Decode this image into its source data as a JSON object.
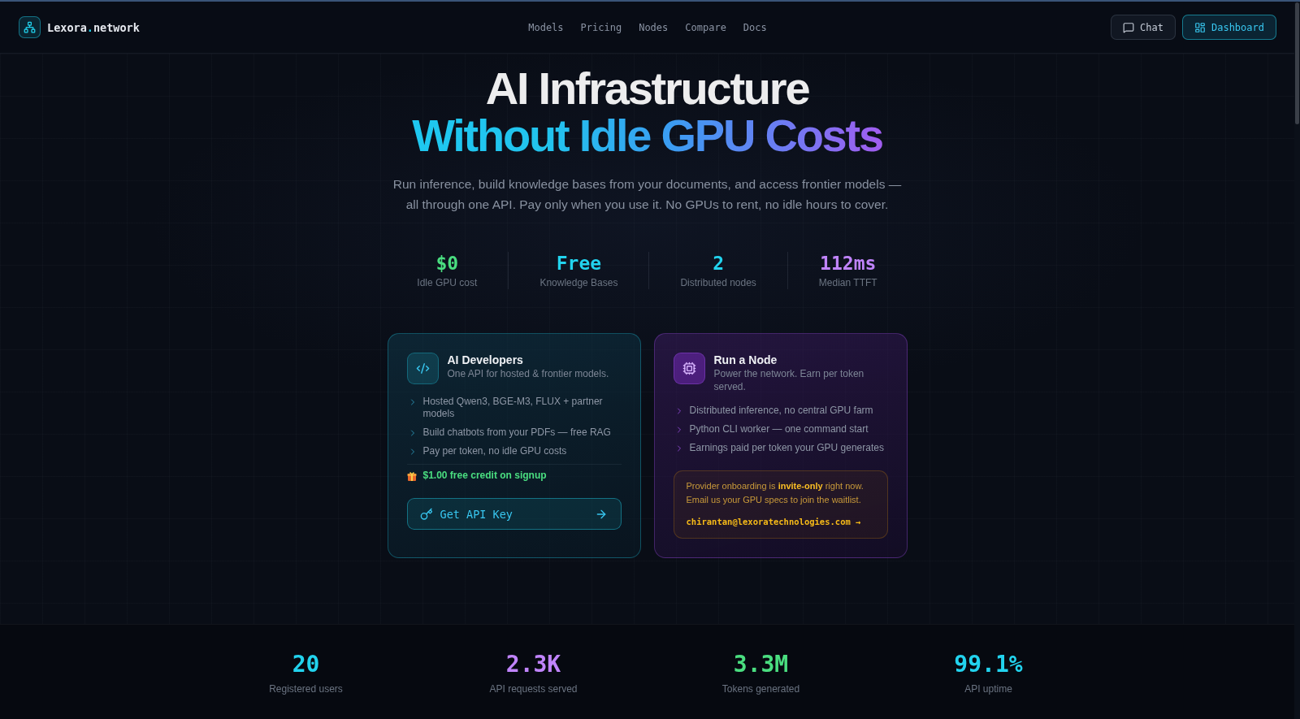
{
  "header": {
    "brand": {
      "name": "Lexora",
      "dot": ".",
      "suffix": "network"
    },
    "nav": [
      {
        "label": "Models"
      },
      {
        "label": "Pricing"
      },
      {
        "label": "Nodes"
      },
      {
        "label": "Compare"
      },
      {
        "label": "Docs"
      }
    ],
    "actions": [
      {
        "kind": "chat",
        "label": "Chat"
      },
      {
        "kind": "dashboard",
        "label": "Dashboard"
      }
    ]
  },
  "hero": {
    "title": "AI Infrastructure",
    "title_highlight": "Without Idle GPU Costs",
    "subtitle": "Run inference, build knowledge bases from your documents, and access frontier models — all through one API. Pay only when you use it. No GPUs to rent, no idle hours to cover."
  },
  "hero_stats": [
    {
      "value": "$0",
      "label": "Idle GPU cost",
      "color": "#4ade80"
    },
    {
      "value": "Free",
      "label": "Knowledge Bases",
      "color": "#22d3ee"
    },
    {
      "value": "2",
      "label": "Distributed nodes",
      "color": "#22d3ee"
    },
    {
      "value": "112ms",
      "label": "Median TTFT",
      "color": "#c084fc"
    }
  ],
  "cards": [
    {
      "kind": "developer",
      "title": "AI Developers",
      "subtitle": "One API for hosted & frontier models.",
      "items": [
        "Hosted Qwen3, BGE-M3, FLUX + partner models",
        "Build chatbots from your PDFs — free RAG",
        "Pay per token, no idle GPU costs"
      ],
      "perk": "$1.00 free credit on signup",
      "button": "Get API Key"
    },
    {
      "kind": "provider",
      "title": "Run a Node",
      "subtitle": "Power the network. Earn per token served.",
      "items": [
        "Distributed inference, no central GPU farm",
        "Python CLI worker — one command start",
        "Earnings paid per token your GPU generates"
      ],
      "notice": "Provider onboarding is **invite-only** right now. Email us your GPU specs to join the waitlist.",
      "email": "chirantan@lexoratechnologies.com →"
    }
  ],
  "metrics": [
    {
      "value": "20",
      "label": "Registered users",
      "color": "#22d3ee"
    },
    {
      "value": "2.3K",
      "label": "API requests served",
      "color": "#c084fc"
    },
    {
      "value": "3.3M",
      "label": "Tokens generated",
      "color": "#4ade80"
    },
    {
      "value": "99.1%",
      "label": "API uptime",
      "color": "#22d3ee"
    }
  ]
}
